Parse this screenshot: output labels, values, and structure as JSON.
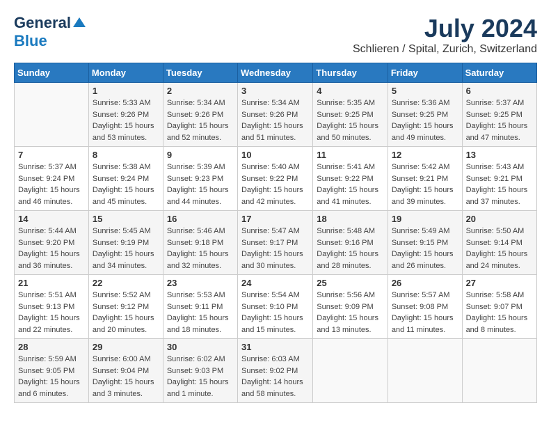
{
  "header": {
    "logo_general": "General",
    "logo_blue": "Blue",
    "title": "July 2024",
    "subtitle": "Schlieren / Spital, Zurich, Switzerland"
  },
  "weekdays": [
    "Sunday",
    "Monday",
    "Tuesday",
    "Wednesday",
    "Thursday",
    "Friday",
    "Saturday"
  ],
  "weeks": [
    [
      {
        "day": "",
        "sunrise": "",
        "sunset": "",
        "daylight": ""
      },
      {
        "day": "1",
        "sunrise": "Sunrise: 5:33 AM",
        "sunset": "Sunset: 9:26 PM",
        "daylight": "Daylight: 15 hours and 53 minutes."
      },
      {
        "day": "2",
        "sunrise": "Sunrise: 5:34 AM",
        "sunset": "Sunset: 9:26 PM",
        "daylight": "Daylight: 15 hours and 52 minutes."
      },
      {
        "day": "3",
        "sunrise": "Sunrise: 5:34 AM",
        "sunset": "Sunset: 9:26 PM",
        "daylight": "Daylight: 15 hours and 51 minutes."
      },
      {
        "day": "4",
        "sunrise": "Sunrise: 5:35 AM",
        "sunset": "Sunset: 9:25 PM",
        "daylight": "Daylight: 15 hours and 50 minutes."
      },
      {
        "day": "5",
        "sunrise": "Sunrise: 5:36 AM",
        "sunset": "Sunset: 9:25 PM",
        "daylight": "Daylight: 15 hours and 49 minutes."
      },
      {
        "day": "6",
        "sunrise": "Sunrise: 5:37 AM",
        "sunset": "Sunset: 9:25 PM",
        "daylight": "Daylight: 15 hours and 47 minutes."
      }
    ],
    [
      {
        "day": "7",
        "sunrise": "Sunrise: 5:37 AM",
        "sunset": "Sunset: 9:24 PM",
        "daylight": "Daylight: 15 hours and 46 minutes."
      },
      {
        "day": "8",
        "sunrise": "Sunrise: 5:38 AM",
        "sunset": "Sunset: 9:24 PM",
        "daylight": "Daylight: 15 hours and 45 minutes."
      },
      {
        "day": "9",
        "sunrise": "Sunrise: 5:39 AM",
        "sunset": "Sunset: 9:23 PM",
        "daylight": "Daylight: 15 hours and 44 minutes."
      },
      {
        "day": "10",
        "sunrise": "Sunrise: 5:40 AM",
        "sunset": "Sunset: 9:22 PM",
        "daylight": "Daylight: 15 hours and 42 minutes."
      },
      {
        "day": "11",
        "sunrise": "Sunrise: 5:41 AM",
        "sunset": "Sunset: 9:22 PM",
        "daylight": "Daylight: 15 hours and 41 minutes."
      },
      {
        "day": "12",
        "sunrise": "Sunrise: 5:42 AM",
        "sunset": "Sunset: 9:21 PM",
        "daylight": "Daylight: 15 hours and 39 minutes."
      },
      {
        "day": "13",
        "sunrise": "Sunrise: 5:43 AM",
        "sunset": "Sunset: 9:21 PM",
        "daylight": "Daylight: 15 hours and 37 minutes."
      }
    ],
    [
      {
        "day": "14",
        "sunrise": "Sunrise: 5:44 AM",
        "sunset": "Sunset: 9:20 PM",
        "daylight": "Daylight: 15 hours and 36 minutes."
      },
      {
        "day": "15",
        "sunrise": "Sunrise: 5:45 AM",
        "sunset": "Sunset: 9:19 PM",
        "daylight": "Daylight: 15 hours and 34 minutes."
      },
      {
        "day": "16",
        "sunrise": "Sunrise: 5:46 AM",
        "sunset": "Sunset: 9:18 PM",
        "daylight": "Daylight: 15 hours and 32 minutes."
      },
      {
        "day": "17",
        "sunrise": "Sunrise: 5:47 AM",
        "sunset": "Sunset: 9:17 PM",
        "daylight": "Daylight: 15 hours and 30 minutes."
      },
      {
        "day": "18",
        "sunrise": "Sunrise: 5:48 AM",
        "sunset": "Sunset: 9:16 PM",
        "daylight": "Daylight: 15 hours and 28 minutes."
      },
      {
        "day": "19",
        "sunrise": "Sunrise: 5:49 AM",
        "sunset": "Sunset: 9:15 PM",
        "daylight": "Daylight: 15 hours and 26 minutes."
      },
      {
        "day": "20",
        "sunrise": "Sunrise: 5:50 AM",
        "sunset": "Sunset: 9:14 PM",
        "daylight": "Daylight: 15 hours and 24 minutes."
      }
    ],
    [
      {
        "day": "21",
        "sunrise": "Sunrise: 5:51 AM",
        "sunset": "Sunset: 9:13 PM",
        "daylight": "Daylight: 15 hours and 22 minutes."
      },
      {
        "day": "22",
        "sunrise": "Sunrise: 5:52 AM",
        "sunset": "Sunset: 9:12 PM",
        "daylight": "Daylight: 15 hours and 20 minutes."
      },
      {
        "day": "23",
        "sunrise": "Sunrise: 5:53 AM",
        "sunset": "Sunset: 9:11 PM",
        "daylight": "Daylight: 15 hours and 18 minutes."
      },
      {
        "day": "24",
        "sunrise": "Sunrise: 5:54 AM",
        "sunset": "Sunset: 9:10 PM",
        "daylight": "Daylight: 15 hours and 15 minutes."
      },
      {
        "day": "25",
        "sunrise": "Sunrise: 5:56 AM",
        "sunset": "Sunset: 9:09 PM",
        "daylight": "Daylight: 15 hours and 13 minutes."
      },
      {
        "day": "26",
        "sunrise": "Sunrise: 5:57 AM",
        "sunset": "Sunset: 9:08 PM",
        "daylight": "Daylight: 15 hours and 11 minutes."
      },
      {
        "day": "27",
        "sunrise": "Sunrise: 5:58 AM",
        "sunset": "Sunset: 9:07 PM",
        "daylight": "Daylight: 15 hours and 8 minutes."
      }
    ],
    [
      {
        "day": "28",
        "sunrise": "Sunrise: 5:59 AM",
        "sunset": "Sunset: 9:05 PM",
        "daylight": "Daylight: 15 hours and 6 minutes."
      },
      {
        "day": "29",
        "sunrise": "Sunrise: 6:00 AM",
        "sunset": "Sunset: 9:04 PM",
        "daylight": "Daylight: 15 hours and 3 minutes."
      },
      {
        "day": "30",
        "sunrise": "Sunrise: 6:02 AM",
        "sunset": "Sunset: 9:03 PM",
        "daylight": "Daylight: 15 hours and 1 minute."
      },
      {
        "day": "31",
        "sunrise": "Sunrise: 6:03 AM",
        "sunset": "Sunset: 9:02 PM",
        "daylight": "Daylight: 14 hours and 58 minutes."
      },
      {
        "day": "",
        "sunrise": "",
        "sunset": "",
        "daylight": ""
      },
      {
        "day": "",
        "sunrise": "",
        "sunset": "",
        "daylight": ""
      },
      {
        "day": "",
        "sunrise": "",
        "sunset": "",
        "daylight": ""
      }
    ]
  ]
}
